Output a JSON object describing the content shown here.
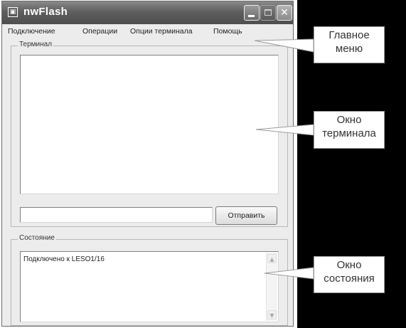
{
  "window": {
    "title": "nwFlash",
    "title_icon": "app-icon",
    "buttons": {
      "minimize_icon": "minimize-icon",
      "maximize_icon": "maximize-icon",
      "close_icon": "close-icon",
      "close_glyph": "✕"
    }
  },
  "menu": {
    "items": [
      {
        "label": "Подключение"
      },
      {
        "label": "Операции"
      },
      {
        "label": "Опции терминала"
      },
      {
        "label": "Помощь"
      }
    ]
  },
  "terminal": {
    "group_label": "Терминал",
    "output_text": "",
    "send_value": "",
    "send_button_label": "Отправить"
  },
  "status": {
    "group_label": "Состояние",
    "text": "Подключено к LESO1/16",
    "scroll_up_glyph": "▲",
    "scroll_down_glyph": "▼"
  },
  "annotations": [
    {
      "line1": "Главное",
      "line2": "меню"
    },
    {
      "line1": "Окно",
      "line2": "терминала"
    },
    {
      "line1": "Окно",
      "line2": "состояния"
    }
  ],
  "colors": {
    "titlebar": "#5e5e5e",
    "window_bg": "#ececec",
    "black_panel": "#000000",
    "callout_border": "#999999"
  }
}
